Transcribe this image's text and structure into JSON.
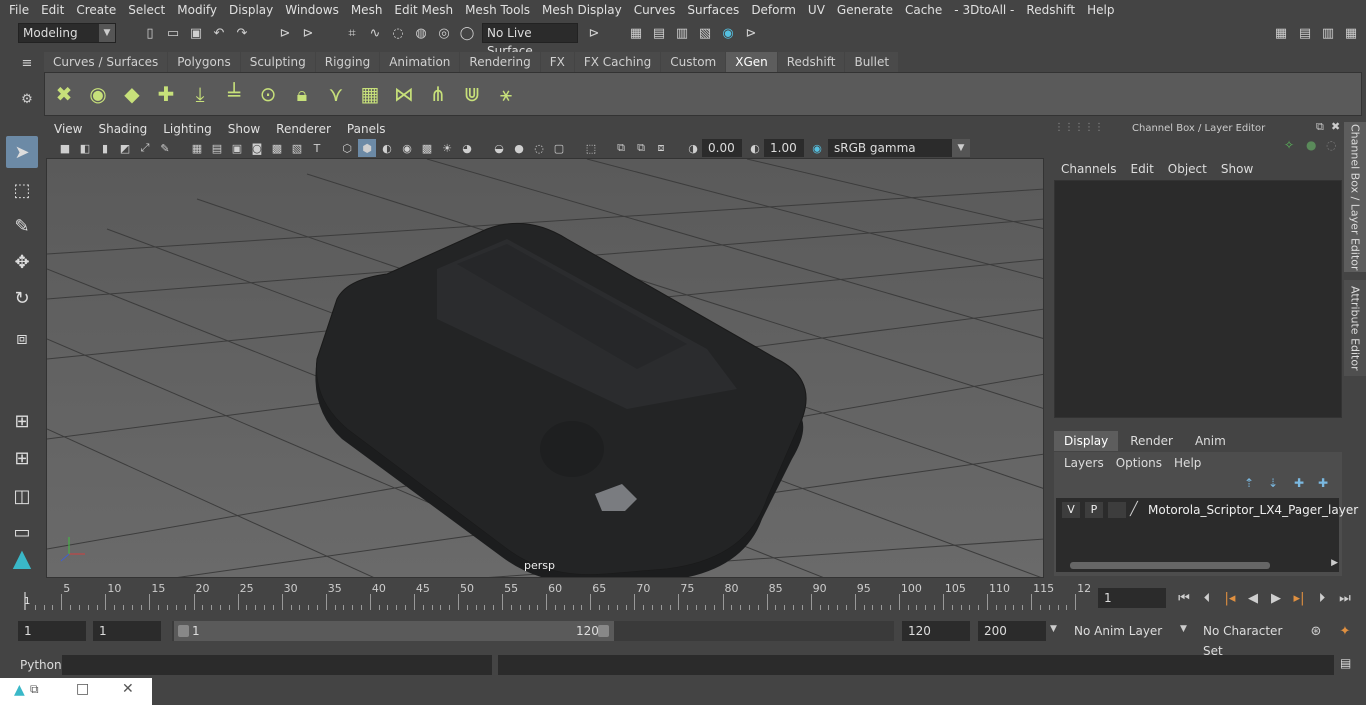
{
  "menubar": [
    "File",
    "Edit",
    "Create",
    "Select",
    "Modify",
    "Display",
    "Windows",
    "Mesh",
    "Edit Mesh",
    "Mesh Tools",
    "Mesh Display",
    "Curves",
    "Surfaces",
    "Deform",
    "UV",
    "Generate",
    "Cache",
    "- 3DtoAll -",
    "Redshift",
    "Help"
  ],
  "status": {
    "mode": "Modeling",
    "live_surface": "No Live Surface"
  },
  "shelf_tabs": [
    "Curves / Surfaces",
    "Polygons",
    "Sculpting",
    "Rigging",
    "Animation",
    "Rendering",
    "FX",
    "FX Caching",
    "Custom",
    "XGen",
    "Redshift",
    "Bullet"
  ],
  "shelf_active": "XGen",
  "viewport": {
    "menu": [
      "View",
      "Shading",
      "Lighting",
      "Show",
      "Renderer",
      "Panels"
    ],
    "exposure": "0.00",
    "gamma": "1.00",
    "colorspace": "sRGB gamma",
    "camera": "persp"
  },
  "channel_box": {
    "title": "Channel Box / Layer Editor",
    "menu": [
      "Channels",
      "Edit",
      "Object",
      "Show"
    ]
  },
  "side_tabs": [
    "Channel Box / Layer Editor",
    "Attribute Editor"
  ],
  "layer_editor": {
    "tabs": [
      "Display",
      "Render",
      "Anim"
    ],
    "active_tab": "Display",
    "menu": [
      "Layers",
      "Options",
      "Help"
    ],
    "layer": {
      "v": "V",
      "p": "P",
      "name": "Motorola_Scriptor_LX4_Pager_layer"
    }
  },
  "timeline": {
    "ticks": [
      "5",
      "10",
      "15",
      "20",
      "25",
      "30",
      "35",
      "40",
      "45",
      "50",
      "55",
      "60",
      "65",
      "70",
      "75",
      "80",
      "85",
      "90",
      "95",
      "100",
      "105",
      "110",
      "115",
      "12"
    ],
    "start_marker": "1",
    "current_frame": "1"
  },
  "range": {
    "start": "1",
    "playback_start": "1",
    "slider_start": "1",
    "slider_end": "120",
    "playback_end": "120",
    "end": "200",
    "anim_layer": "No Anim Layer",
    "character_set": "No Character Set"
  },
  "command": {
    "label": "Python"
  }
}
